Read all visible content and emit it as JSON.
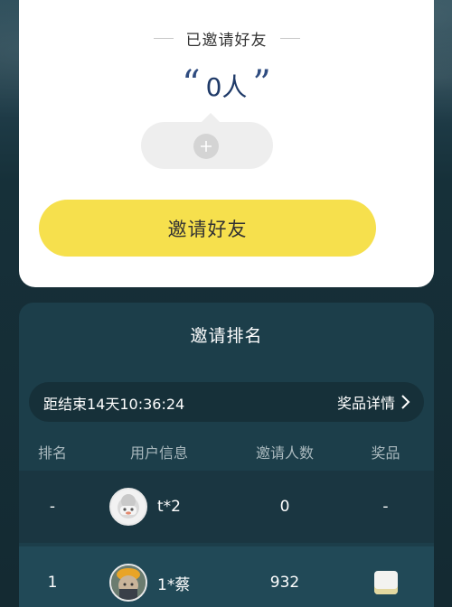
{
  "invite": {
    "title": "已邀请好友",
    "count_prefix": "“",
    "count_text": "0人",
    "count_suffix": "”",
    "add_icon": "plus-icon",
    "button_label": "邀请好友"
  },
  "ranking": {
    "title": "邀请排名",
    "countdown": "距结束14天10:36:24",
    "prize_detail_label": "奖品详情",
    "columns": [
      "排名",
      "用户信息",
      "邀请人数",
      "奖品"
    ],
    "rows": [
      {
        "rank": "-",
        "user": "t*2",
        "count": "0",
        "prize": "-"
      },
      {
        "rank": "1",
        "user": "1*蔡",
        "count": "932",
        "prize": ""
      }
    ]
  },
  "colors": {
    "accent_yellow": "#f6e04d",
    "panel_bg": "#1c3e4a",
    "count_color": "#1f3a68"
  }
}
